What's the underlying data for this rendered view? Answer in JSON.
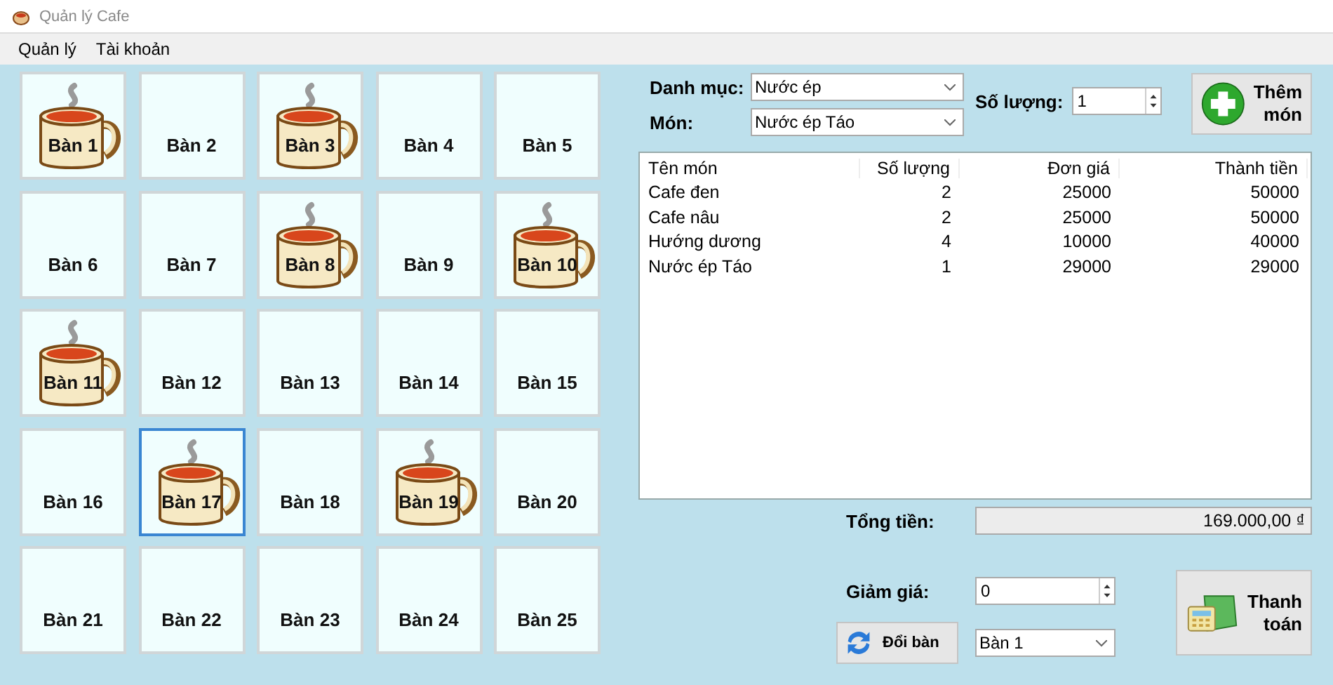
{
  "window": {
    "title": "Quản lý Cafe"
  },
  "menu": [
    "Quản lý",
    "Tài khoản"
  ],
  "tables": [
    {
      "label": "Bàn 1",
      "occupied": true,
      "selected": false
    },
    {
      "label": "Bàn 2",
      "occupied": false,
      "selected": false
    },
    {
      "label": "Bàn 3",
      "occupied": true,
      "selected": false
    },
    {
      "label": "Bàn 4",
      "occupied": false,
      "selected": false
    },
    {
      "label": "Bàn 5",
      "occupied": false,
      "selected": false
    },
    {
      "label": "Bàn 6",
      "occupied": false,
      "selected": false
    },
    {
      "label": "Bàn 7",
      "occupied": false,
      "selected": false
    },
    {
      "label": "Bàn 8",
      "occupied": true,
      "selected": false
    },
    {
      "label": "Bàn 9",
      "occupied": false,
      "selected": false
    },
    {
      "label": "Bàn 10",
      "occupied": true,
      "selected": false
    },
    {
      "label": "Bàn 11",
      "occupied": true,
      "selected": false
    },
    {
      "label": "Bàn 12",
      "occupied": false,
      "selected": false
    },
    {
      "label": "Bàn 13",
      "occupied": false,
      "selected": false
    },
    {
      "label": "Bàn 14",
      "occupied": false,
      "selected": false
    },
    {
      "label": "Bàn 15",
      "occupied": false,
      "selected": false
    },
    {
      "label": "Bàn 16",
      "occupied": false,
      "selected": false
    },
    {
      "label": "Bàn 17",
      "occupied": true,
      "selected": true
    },
    {
      "label": "Bàn 18",
      "occupied": false,
      "selected": false
    },
    {
      "label": "Bàn 19",
      "occupied": true,
      "selected": false
    },
    {
      "label": "Bàn 20",
      "occupied": false,
      "selected": false
    },
    {
      "label": "Bàn 21",
      "occupied": false,
      "selected": false
    },
    {
      "label": "Bàn 22",
      "occupied": false,
      "selected": false
    },
    {
      "label": "Bàn 23",
      "occupied": false,
      "selected": false
    },
    {
      "label": "Bàn 24",
      "occupied": false,
      "selected": false
    },
    {
      "label": "Bàn 25",
      "occupied": false,
      "selected": false
    }
  ],
  "order_form": {
    "category_label": "Danh mục:",
    "category": "Nước ép",
    "item_label": "Món:",
    "item": "Nước ép Táo",
    "quantity_label": "Số lượng:",
    "quantity": "1",
    "add_button": "Thêm món"
  },
  "order_table": {
    "columns": [
      "Tên món",
      "Số lượng",
      "Đơn giá",
      "Thành tiền"
    ],
    "rows": [
      [
        "Cafe đen",
        "2",
        "25000",
        "50000"
      ],
      [
        "Cafe nâu",
        "2",
        "25000",
        "50000"
      ],
      [
        "Hướng dương",
        "4",
        "10000",
        "40000"
      ],
      [
        "Nước ép Táo",
        "1",
        "29000",
        "29000"
      ]
    ]
  },
  "total": {
    "label": "Tổng tiền:",
    "value": "169.000,00 ₫"
  },
  "discount": {
    "label": "Giảm giá:",
    "value": "0"
  },
  "switch_table": {
    "button": "Đổi bàn",
    "target": "Bàn 1"
  },
  "pay_button": "Thanh toán"
}
